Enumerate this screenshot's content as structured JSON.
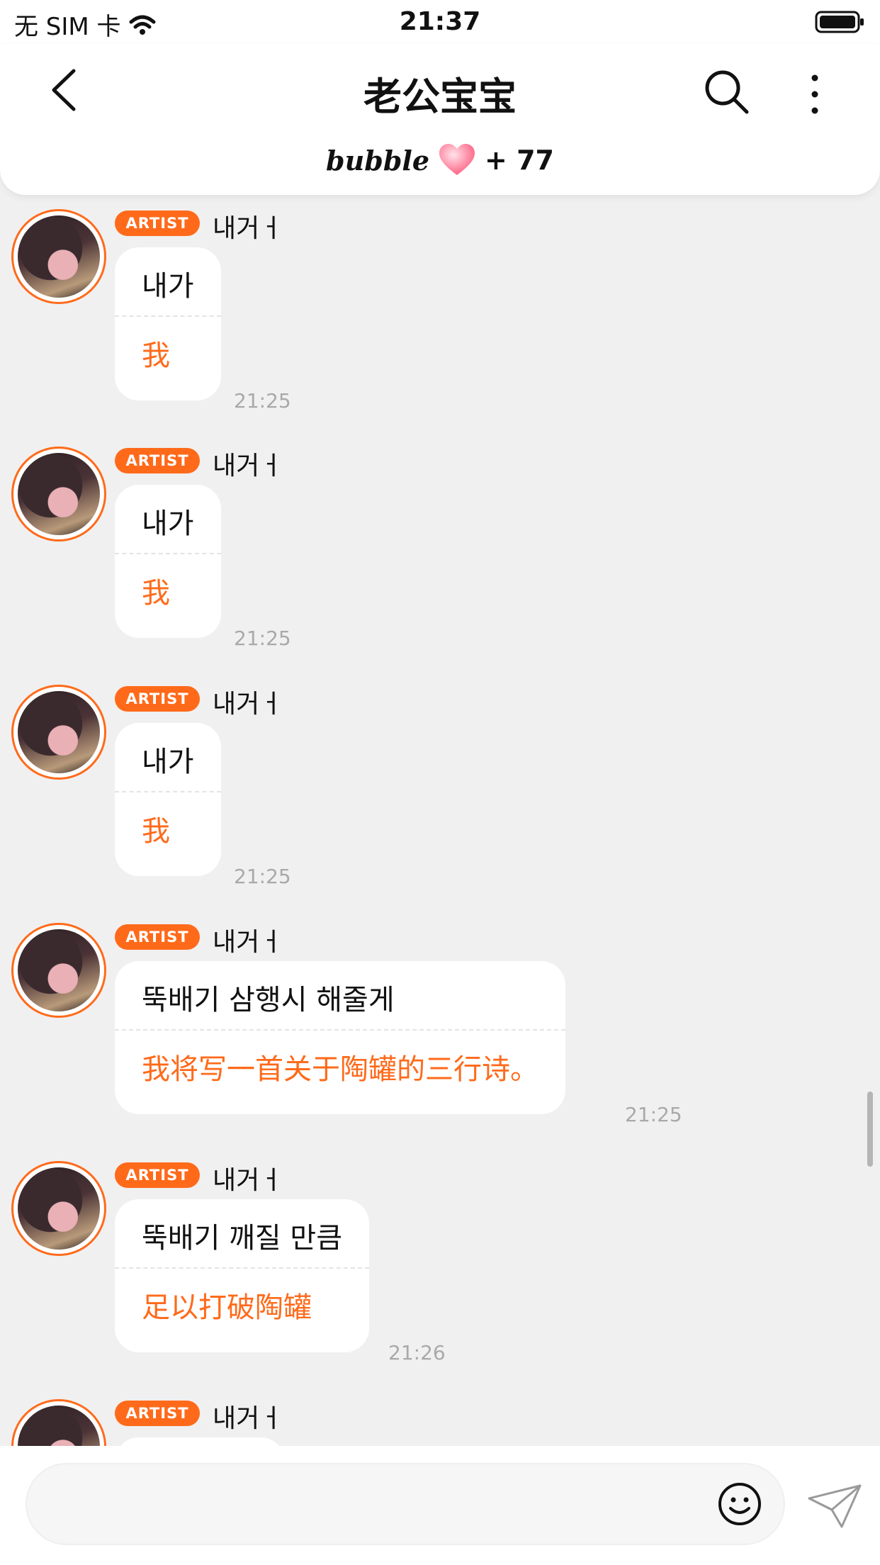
{
  "status_bar": {
    "carrier": "无 SIM 卡",
    "time": "21:37"
  },
  "header": {
    "title": "老公宝宝",
    "bubble_logo": "bubble",
    "bubble_count": "+ 77"
  },
  "messages": [
    {
      "badge": "ARTIST",
      "name": "내거ㅓ",
      "original": "내가",
      "translation": "我",
      "time": "21:25"
    },
    {
      "badge": "ARTIST",
      "name": "내거ㅓ",
      "original": "내가",
      "translation": "我",
      "time": "21:25"
    },
    {
      "badge": "ARTIST",
      "name": "내거ㅓ",
      "original": "내가",
      "translation": "我",
      "time": "21:25"
    },
    {
      "badge": "ARTIST",
      "name": "내거ㅓ",
      "original": "뚝배기 삼행시 해줄게",
      "translation": "我将写一首关于陶罐的三行诗。",
      "time": "21:25"
    },
    {
      "badge": "ARTIST",
      "name": "내거ㅓ",
      "original": "뚝배기 깨질 만큼",
      "translation": "足以打破陶罐",
      "time": "21:26"
    },
    {
      "badge": "ARTIST",
      "name": "내거ㅓ"
    }
  ],
  "composer": {
    "placeholder": ""
  },
  "icons": {
    "back": "chevron-left-icon",
    "search": "search-icon",
    "more": "more-vertical-icon",
    "heart": "heart-icon",
    "emoji": "smiley-icon",
    "send": "paper-plane-icon",
    "wifi": "wifi-icon",
    "battery": "battery-icon"
  },
  "colors": {
    "accent": "#ff6a1a",
    "background": "#f0f0f0",
    "bubble": "#ffffff",
    "timestamp": "#a9a9a9"
  }
}
